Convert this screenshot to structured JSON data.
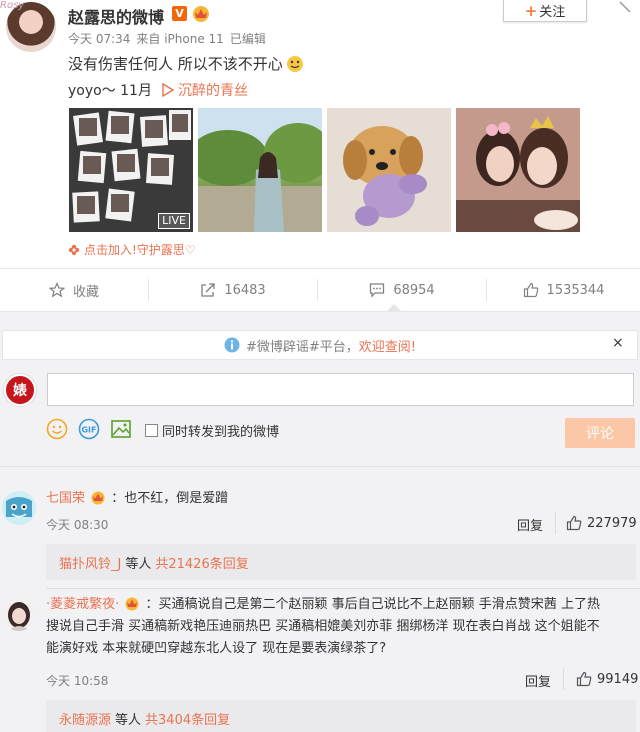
{
  "post": {
    "avatar_tag": "Rosy",
    "username": "赵露思的微博",
    "verified_label": "V",
    "follow_label": "关注",
    "time": "今天 07:34",
    "source": "来自 iPhone 11",
    "edited": "已编辑",
    "text": "没有伤害任何人 所以不该不开心",
    "music_prefix": "yoyo～ 11月",
    "music_link": "沉醉的青丝",
    "photo1_badge": "LIVE",
    "guard_text": "点击加入!守护露思♡"
  },
  "actions": {
    "favorite_label": "收藏",
    "repost_count": "16483",
    "comment_count": "68954",
    "like_count": "1535344"
  },
  "notice": {
    "prefix": "#微博辟谣#平台，",
    "link": "欢迎查阅!",
    "close": "×"
  },
  "composer": {
    "my_avatar": "婊",
    "repost_checkbox_label": "同时转发到我的微博",
    "submit_label": "评论"
  },
  "comments": [
    {
      "user": "七国荣",
      "text": "：也不红，倒是爱蹭",
      "time": "今天 08:30",
      "reply_label": "回复",
      "likes": "227979",
      "reply_user": "猫扑风铃_J",
      "reply_mid": "等人",
      "reply_count": "共21426条回复"
    },
    {
      "user": "·菱菱戒繁夜·",
      "text_line1": "：买通稿说自己是第二个赵丽颖  事后自己说比不上赵丽颖 手滑点赞宋茜 上了热",
      "text_line2": "搜说自己手滑  买通稿新戏艳压迪丽热巴  买通稿相媲美刘亦菲 捆绑杨洋 现在表白肖战 这个姐能不",
      "text_line3": "能演好戏 本来就硬凹穿越东北人设了 现在是要表演绿茶了?",
      "time": "今天 10:58",
      "reply_label": "回复",
      "likes": "99149",
      "reply_user": "永随源源",
      "reply_mid": "等人",
      "reply_count": "共3404条回复"
    }
  ],
  "colors": {
    "accent": "#eb7350",
    "verified": "#f3670b",
    "submit_disabled": "#fcc7a7"
  }
}
